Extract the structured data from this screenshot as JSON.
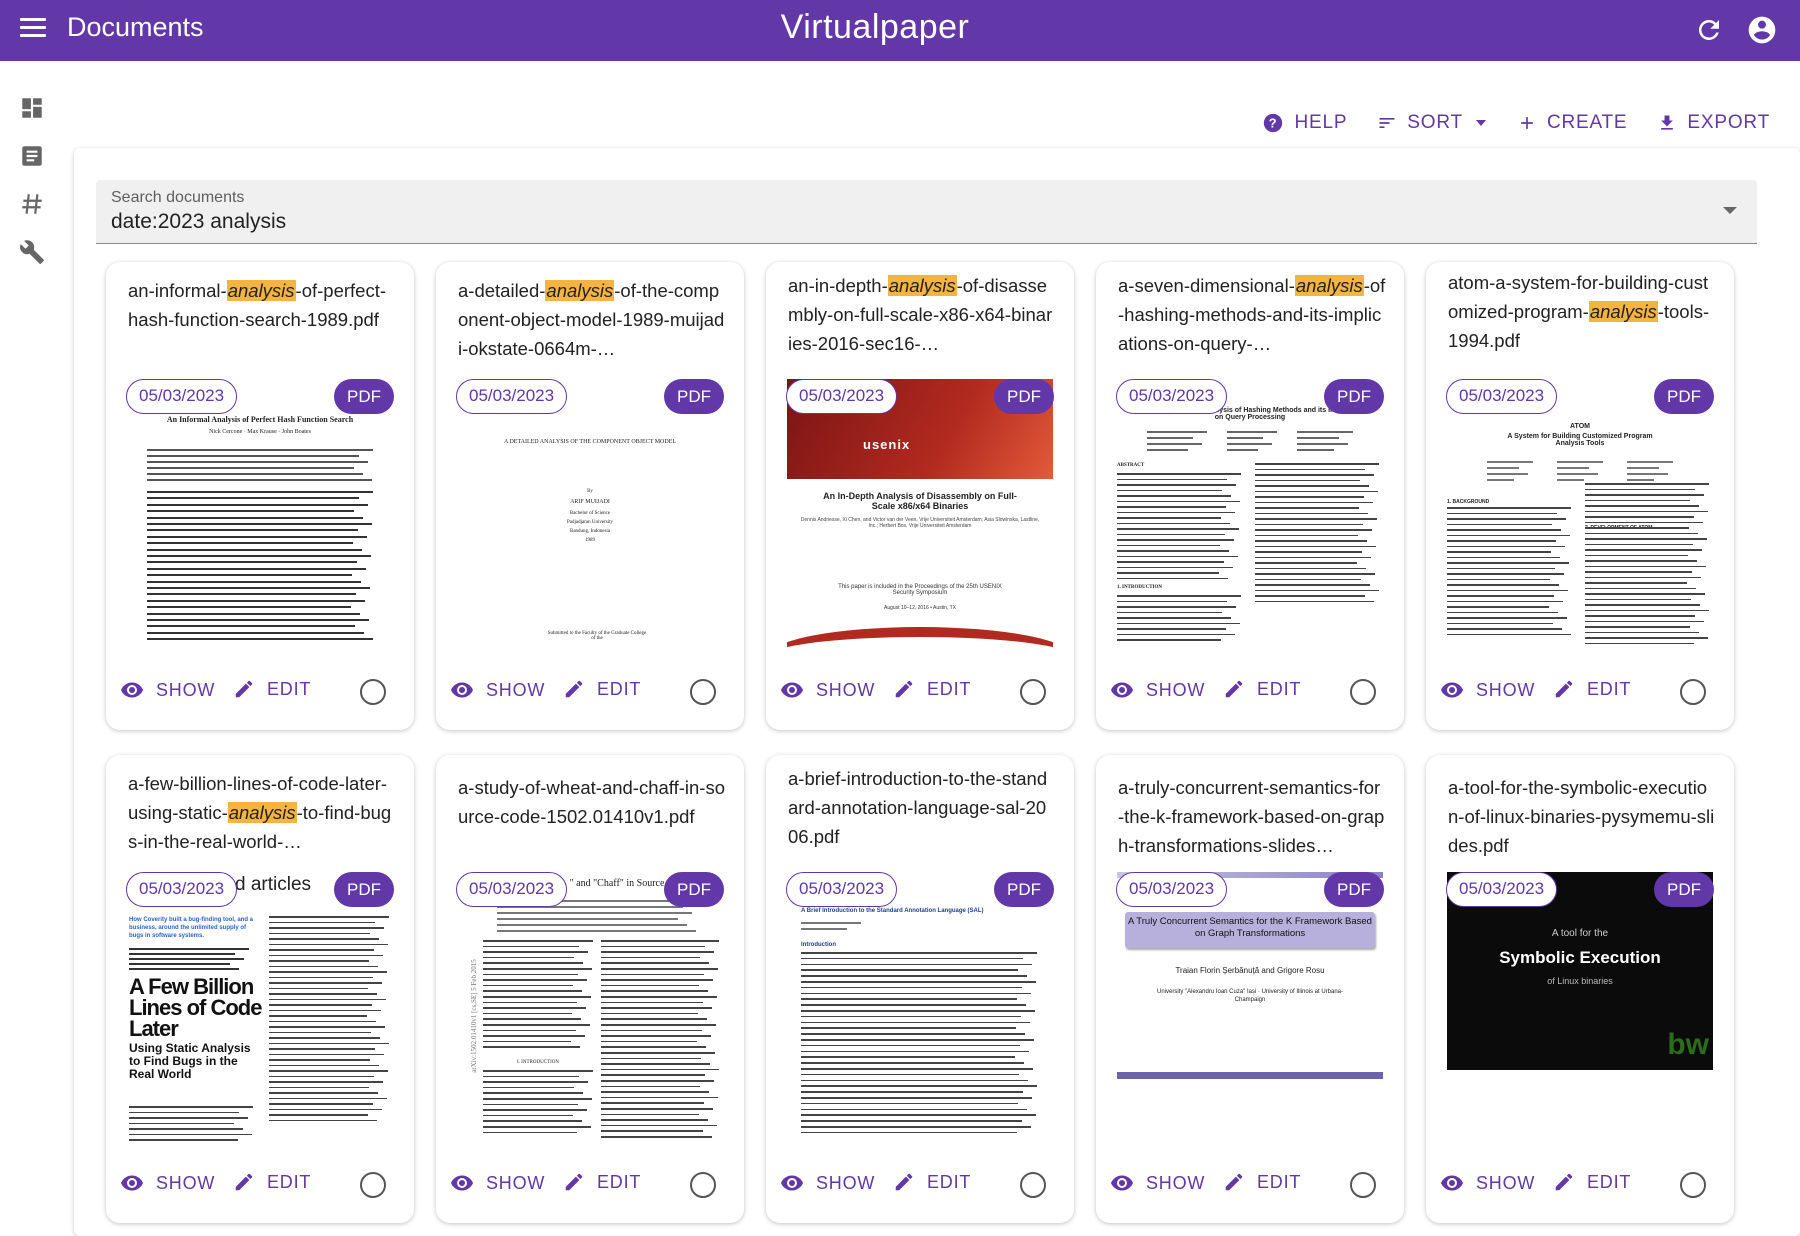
{
  "appbar": {
    "title": "Documents",
    "brand": "Virtualpaper",
    "icons": {
      "menu": "menu-icon",
      "refresh": "refresh-icon",
      "account": "account-circle-icon"
    },
    "color": "#6237a8"
  },
  "rail": {
    "items": [
      {
        "icon": "dashboard-icon"
      },
      {
        "icon": "document-icon"
      },
      {
        "icon": "hashtag-icon"
      },
      {
        "icon": "tools-icon"
      }
    ]
  },
  "toolbar": {
    "help": "HELP",
    "sort": "SORT",
    "create": "CREATE",
    "export": "EXPORT"
  },
  "search": {
    "label": "Search documents",
    "value": "date:2023 analysis"
  },
  "cards": [
    {
      "pre": "an-informal-",
      "hl": "analysis",
      "post": "-of-perfect-hash-function-search-1989.pdf",
      "date": "05/03/2023",
      "type": "PDF",
      "show": "SHOW",
      "edit": "EDIT",
      "thumb": {
        "kind": "paper1",
        "title": "An Informal Analysis of Perfect Hash Function Search",
        "authors": "Nick Cercone · Max Krause · John Boates"
      }
    },
    {
      "pre": "a-detailed-",
      "hl": "analysis",
      "post": "-of-the-component-object-model-1989-muijadi-okstate-0664m-…",
      "date": "05/03/2023",
      "type": "PDF",
      "show": "SHOW",
      "edit": "EDIT",
      "thumb": {
        "kind": "thesis",
        "title": "A DETAILED ANALYSIS OF THE COMPONENT OBJECT MODEL",
        "by": "By",
        "author": "ARIF MUIJADI",
        "degree": "Bachelor of Science",
        "school": "Padjadjaran University",
        "city": "Bandung, Indonesia",
        "year": "1989",
        "footer": "Submitted to the Faculty of the Graduate College of the"
      }
    },
    {
      "pre": "an-in-depth-",
      "hl": "analysis",
      "post": "-of-disassembly-on-full-scale-x86-x64-binaries-2016-sec16-…",
      "date": "05/03/2023",
      "type": "PDF",
      "show": "SHOW",
      "edit": "EDIT",
      "thumb": {
        "kind": "usenix",
        "logo": "usenix",
        "title": "An In-Depth Analysis of Disassembly on Full-Scale x86/x64 Binaries",
        "authors": "Dennis Andriesse, Xi Chen, and Victor van der Veen, Vrije Universiteit Amsterdam; Asia Slowinska, Lastline, Inc.; Herbert Bos, Vrije Universiteit Amsterdam",
        "note": "This paper is included in the Proceedings of the 25th USENIX Security Symposium",
        "place": "August 10–12, 2016 • Austin, TX"
      }
    },
    {
      "pre": "a-seven-dimensional-",
      "hl": "analysis",
      "post": "-of-hashing-methods-and-its-implications-on-query-…",
      "date": "05/03/2023",
      "type": "PDF",
      "show": "SHOW",
      "edit": "EDIT",
      "thumb": {
        "kind": "paper2",
        "title": "A Seven-Dimensional Analysis of Hashing Methods and its Implications on Query Processing",
        "abstract": "ABSTRACT",
        "intro": "1. INTRODUCTION"
      }
    },
    {
      "pre": "atom-a-system-for-building-customized-program-",
      "hl": "analysis",
      "post": "-tools-1994.pdf",
      "date": "05/03/2023",
      "type": "PDF",
      "show": "SHOW",
      "edit": "EDIT",
      "thumb": {
        "kind": "paper3",
        "head": "ATOM",
        "title": "A System for Building Customized Program Analysis Tools",
        "s1": "1. BACKGROUND",
        "s2": "2. DEVELOPMENT OF ATOM"
      }
    },
    {
      "pre": "a-few-billion-lines-of-code-later-using-static-",
      "hl": "analysis",
      "post": "-to-find-bugs-in-the-real-world-…",
      "date": "05/03/2023",
      "type": "PDF",
      "show": "SHOW",
      "edit": "EDIT",
      "thumb": {
        "kind": "cacm",
        "overlay": "d articles",
        "lede": "How Coverity built a bug-finding tool, and a business, around the unlimited supply of bugs in software systems.",
        "big": "A Few Billion Lines of Code Later",
        "sub": "Using Static Analysis to Find Bugs in the Real World"
      }
    },
    {
      "pre": "a-study-of-wheat-and-chaff-in-source-code-1502.01410v1.pdf",
      "hl": "",
      "post": "",
      "date": "05/03/2023",
      "type": "PDF",
      "show": "SHOW",
      "edit": "EDIT",
      "thumb": {
        "kind": "arxiv",
        "title": "\" and \"Chaff\" in Source",
        "side": "arXiv:1502.01410v1 [cs.SE] 5 Feb 2015",
        "intro": "I. INTRODUCTION"
      }
    },
    {
      "pre": "a-brief-introduction-to-the-standard-annotation-language-sal-2006.pdf",
      "hl": "",
      "post": "",
      "date": "05/03/2023",
      "type": "PDF",
      "show": "SHOW",
      "edit": "EDIT",
      "thumb": {
        "kind": "sal",
        "title": "A Brief Introduction to the Standard Annotation Language (SAL)",
        "intro": "Introduction"
      }
    },
    {
      "pre": "a-truly-concurrent-semantics-for-the-k-framework-based-on-graph-transformations-slides…",
      "hl": "",
      "post": "",
      "date": "05/03/2023",
      "type": "PDF",
      "show": "SHOW",
      "edit": "EDIT",
      "thumb": {
        "kind": "slides",
        "title": "A Truly Concurrent Semantics for the K Framework Based on Graph Transformations",
        "authors": "Traian Florin Șerbănuță and Grigore Rosu",
        "aff": "University \"Alexandru Ioan Cuza\" Iași · University of Illinois at Urbana-Champaign"
      }
    },
    {
      "pre": "a-tool-for-the-symbolic-execution-of-linux-binaries-pysymemu-slides.pdf",
      "hl": "",
      "post": "",
      "date": "05/03/2023",
      "type": "PDF",
      "show": "SHOW",
      "edit": "EDIT",
      "thumb": {
        "kind": "dark",
        "pre": "A tool for the",
        "big": "Symbolic Execution",
        "post": "of Linux binaries",
        "mark": "bw"
      }
    }
  ]
}
